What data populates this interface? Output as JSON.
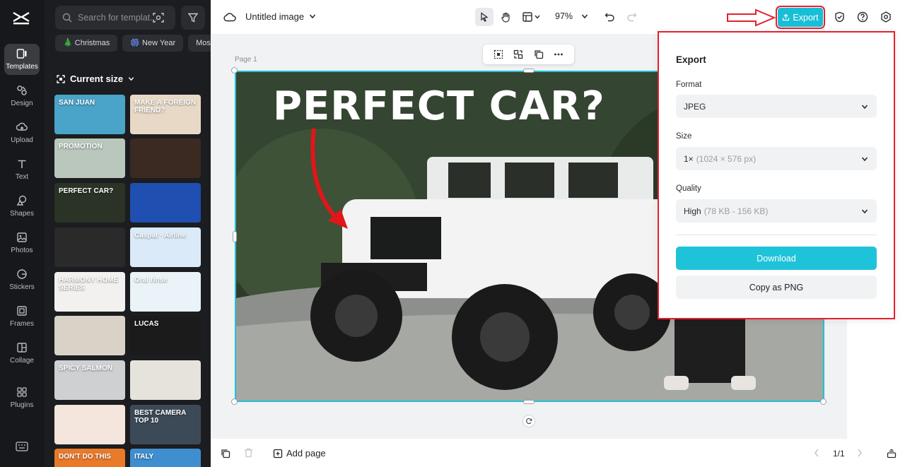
{
  "sidebar": {
    "items": [
      {
        "label": "Templates",
        "icon": "templates-icon",
        "active": true
      },
      {
        "label": "Design",
        "icon": "design-icon"
      },
      {
        "label": "Upload",
        "icon": "upload-icon"
      },
      {
        "label": "Text",
        "icon": "text-icon"
      },
      {
        "label": "Shapes",
        "icon": "shapes-icon"
      },
      {
        "label": "Photos",
        "icon": "photos-icon"
      },
      {
        "label": "Stickers",
        "icon": "stickers-icon"
      },
      {
        "label": "Frames",
        "icon": "frames-icon"
      },
      {
        "label": "Collage",
        "icon": "collage-icon"
      },
      {
        "label": "Plugins",
        "icon": "plugins-icon"
      }
    ]
  },
  "templates": {
    "search_placeholder": "Search for templat...",
    "chips": [
      "🎄 Christmas",
      "🎆 New Year",
      "Mos"
    ],
    "size_label": "Current size",
    "tiles": [
      {
        "text": "SAN JUAN",
        "bg": "#4aa3c9"
      },
      {
        "text": "MAKE A FOREIGN FRIEND?",
        "bg": "#e8d9c7"
      },
      {
        "text": "PROMOTION",
        "bg": "#b9c7bd"
      },
      {
        "text": "",
        "bg": "#3a2a22"
      },
      {
        "text": "PERFECT CAR?",
        "bg": "#2b3326"
      },
      {
        "text": "",
        "bg": "#1f4fb0"
      },
      {
        "text": "",
        "bg": "#2a2a2a"
      },
      {
        "text": "Caspat · Airline",
        "bg": "#dbeaf8"
      },
      {
        "text": "HARMONY HOME SERIES",
        "bg": "#f2f1ef"
      },
      {
        "text": "Oral rinse",
        "bg": "#e9f3f8"
      },
      {
        "text": "",
        "bg": "#d9d2c7"
      },
      {
        "text": "LUCAS",
        "bg": "#1b1b1b"
      },
      {
        "text": "SPICY SALMON",
        "bg": "#cfd0d2"
      },
      {
        "text": "",
        "bg": "#e6e2dc"
      },
      {
        "text": "",
        "bg": "#f4e6dc"
      },
      {
        "text": "BEST CAMERA TOP 10",
        "bg": "#3c4a58"
      },
      {
        "text": "DON'T DO THIS",
        "bg": "#e87a2a"
      },
      {
        "text": "ITALY",
        "bg": "#3f8fd0"
      }
    ]
  },
  "topbar": {
    "title": "Untitled image",
    "zoom": "97%",
    "export_label": "Export"
  },
  "canvas": {
    "page_label": "Page 1",
    "headline": "PERFECT CAR?"
  },
  "export_panel": {
    "title": "Export",
    "format_label": "Format",
    "format_value": "JPEG",
    "size_label": "Size",
    "size_value": "1×",
    "size_hint": "(1024 × 576 px)",
    "quality_label": "Quality",
    "quality_value": "High",
    "quality_hint": "(78 KB - 156 KB)",
    "download_label": "Download",
    "copy_label": "Copy as PNG"
  },
  "bottombar": {
    "add_page_label": "Add page",
    "pager": "1/1"
  },
  "colors": {
    "accent": "#17bfd6",
    "annotation_red": "#e5202e",
    "sidebar_bg": "#17181b"
  }
}
